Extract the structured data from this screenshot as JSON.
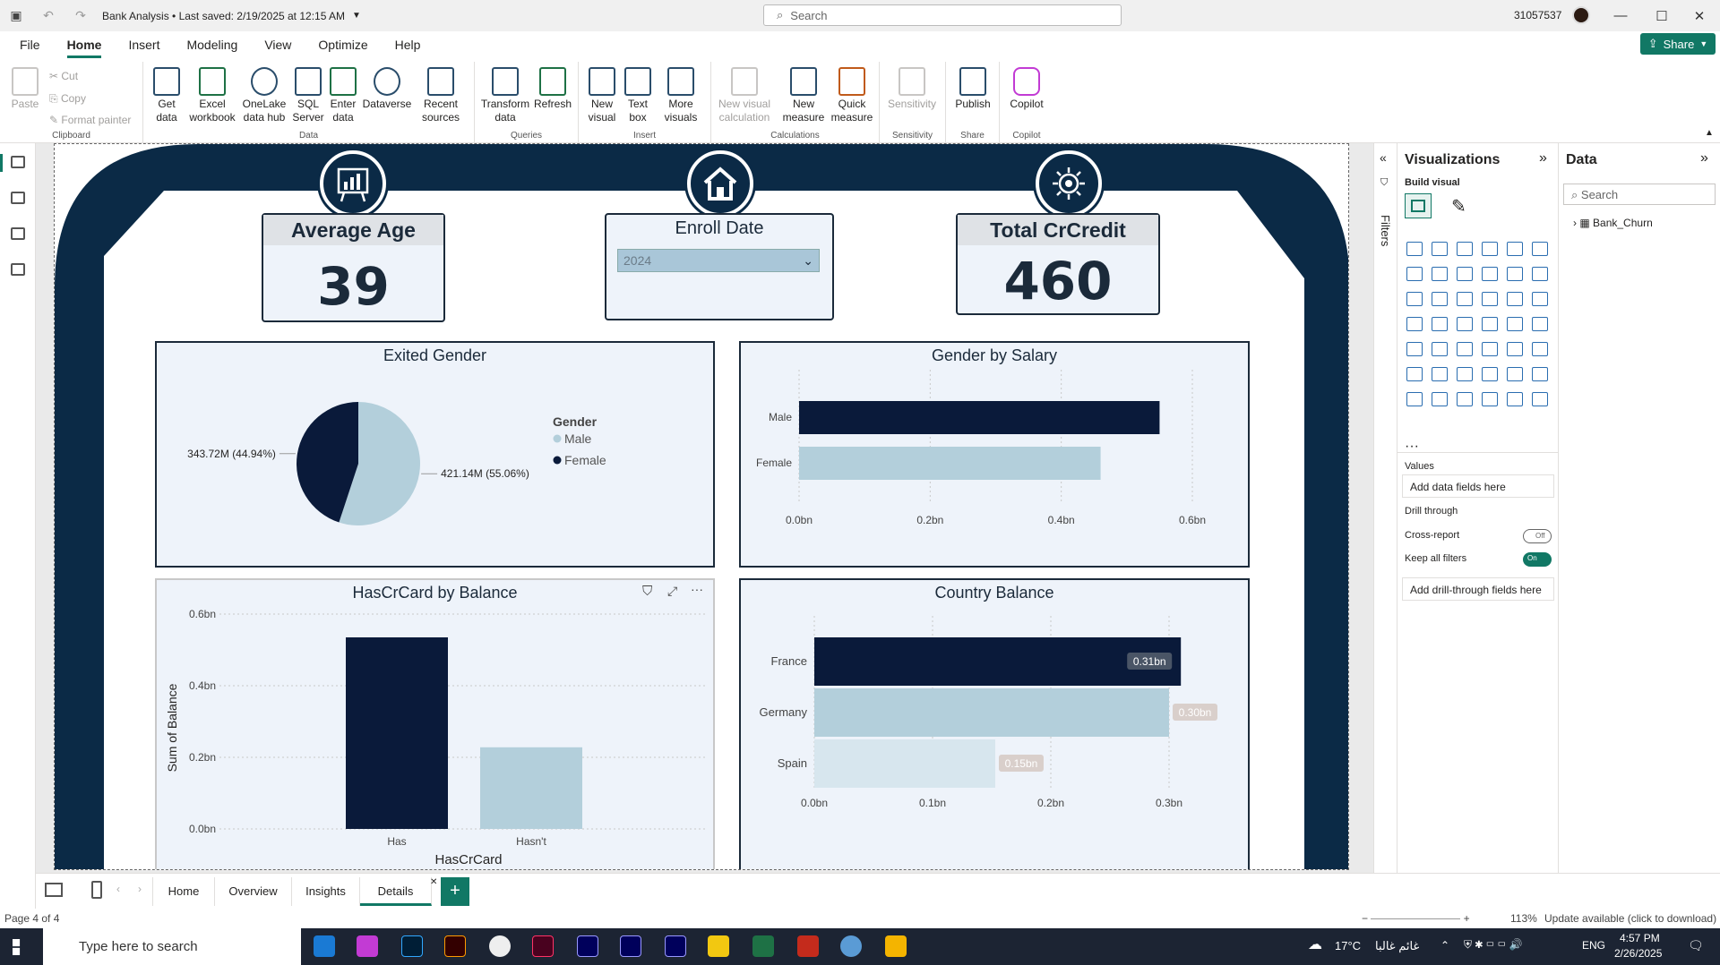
{
  "titlebar": {
    "title": "Bank Analysis • Last saved: 2/19/2025 at 12:15 AM",
    "search": "Search",
    "user": "31057537"
  },
  "menu": {
    "items": [
      "File",
      "Home",
      "Insert",
      "Modeling",
      "View",
      "Optimize",
      "Help"
    ],
    "share": "Share"
  },
  "ribbon": {
    "clipboard": {
      "paste": "Paste",
      "cut": "Cut",
      "copy": "Copy",
      "format_painter": "Format painter",
      "label": "Clipboard"
    },
    "data": {
      "get_data": "Get data",
      "excel": "Excel workbook",
      "onelake": "OneLake data hub",
      "sql": "SQL Server",
      "enter": "Enter data",
      "dataverse": "Dataverse",
      "recent": "Recent sources",
      "label": "Data"
    },
    "queries": {
      "transform": "Transform data",
      "refresh": "Refresh",
      "label": "Queries"
    },
    "insert": {
      "new_visual": "New visual",
      "text_box": "Text box",
      "more_visuals": "More visuals",
      "label": "Insert"
    },
    "calculations": {
      "new_visual_calc": "New visual calculation",
      "new_measure": "New measure",
      "quick_measure": "Quick measure",
      "label": "Calculations"
    },
    "sensitivity": {
      "btn": "Sensitivity",
      "label": "Sensitivity"
    },
    "share": {
      "publish": "Publish",
      "label": "Share"
    },
    "copilot": {
      "btn": "Copilot",
      "label": "Copilot"
    }
  },
  "kpis": {
    "avg_age": {
      "title": "Average Age",
      "value": "39"
    },
    "enroll": {
      "title": "Enroll Date",
      "value": "2024"
    },
    "crcredit": {
      "title": "Total CrCredit",
      "value": "460"
    }
  },
  "visual_titles": {
    "exited": "Exited Gender",
    "salary": "Gender by Salary",
    "hascr": "HasCrCard by Balance",
    "country": "Country Balance"
  },
  "chart_data": [
    {
      "type": "pie",
      "title": "Exited Gender",
      "legend_title": "Gender",
      "slices": [
        {
          "name": "Male",
          "value": 421.14,
          "label": "421.14M (55.06%)",
          "color": "#b3cfdb"
        },
        {
          "name": "Female",
          "value": 343.72,
          "label": "343.72M (44.94%)",
          "color": "#0a1a3a"
        }
      ]
    },
    {
      "type": "bar",
      "orientation": "horizontal",
      "title": "Gender by Salary",
      "categories": [
        "Male",
        "Female"
      ],
      "values": [
        0.55,
        0.46
      ],
      "colors": [
        "#0a1a3a",
        "#b3cfdb"
      ],
      "xticks": [
        "0.0bn",
        "0.2bn",
        "0.4bn",
        "0.6bn"
      ],
      "xlim": [
        0,
        0.6
      ]
    },
    {
      "type": "bar",
      "title": "HasCrCard by Balance",
      "categories": [
        "Has",
        "Hasn't"
      ],
      "values": [
        0.535,
        0.228
      ],
      "colors": [
        "#0a1a3a",
        "#b3cfdb"
      ],
      "yticks": [
        "0.0bn",
        "0.2bn",
        "0.4bn",
        "0.6bn"
      ],
      "ylim": [
        0,
        0.6
      ],
      "xlabel": "HasCrCard",
      "ylabel": "Sum of Balance"
    },
    {
      "type": "bar",
      "orientation": "horizontal",
      "title": "Country Balance",
      "categories": [
        "France",
        "Germany",
        "Spain"
      ],
      "values": [
        0.31,
        0.3,
        0.153
      ],
      "data_labels": [
        "0.31bn",
        "0.30bn",
        "0.15bn"
      ],
      "colors": [
        "#0a1a3a",
        "#b3cfdb",
        "#d7e6ee"
      ],
      "xticks": [
        "0.0bn",
        "0.1bn",
        "0.2bn",
        "0.3bn"
      ],
      "xlim": [
        0,
        0.3
      ]
    }
  ],
  "filters": {
    "label": "Filters"
  },
  "viz_pane": {
    "title": "Visualizations",
    "build_visual": "Build visual",
    "values": "Values",
    "add_fields": "Add data fields here",
    "drill_through": "Drill through",
    "cross_report": "Cross-report",
    "cross_state": "Off",
    "keep_filters": "Keep all filters",
    "keep_state": "On",
    "add_drill": "Add drill-through fields here"
  },
  "data_pane": {
    "title": "Data",
    "search": "Search",
    "table": "Bank_Churn"
  },
  "tabs": [
    "Home",
    "Overview",
    "Insights",
    "Details"
  ],
  "status": {
    "page": "Page 4 of 4",
    "zoom": "113%",
    "update": "Update available (click to download)"
  },
  "taskbar": {
    "search": "Type here to search",
    "weather": "17°C",
    "weather_text": "غائم غالبا",
    "lang": "ENG",
    "time": "4:57 PM",
    "date": "2/26/2025"
  }
}
